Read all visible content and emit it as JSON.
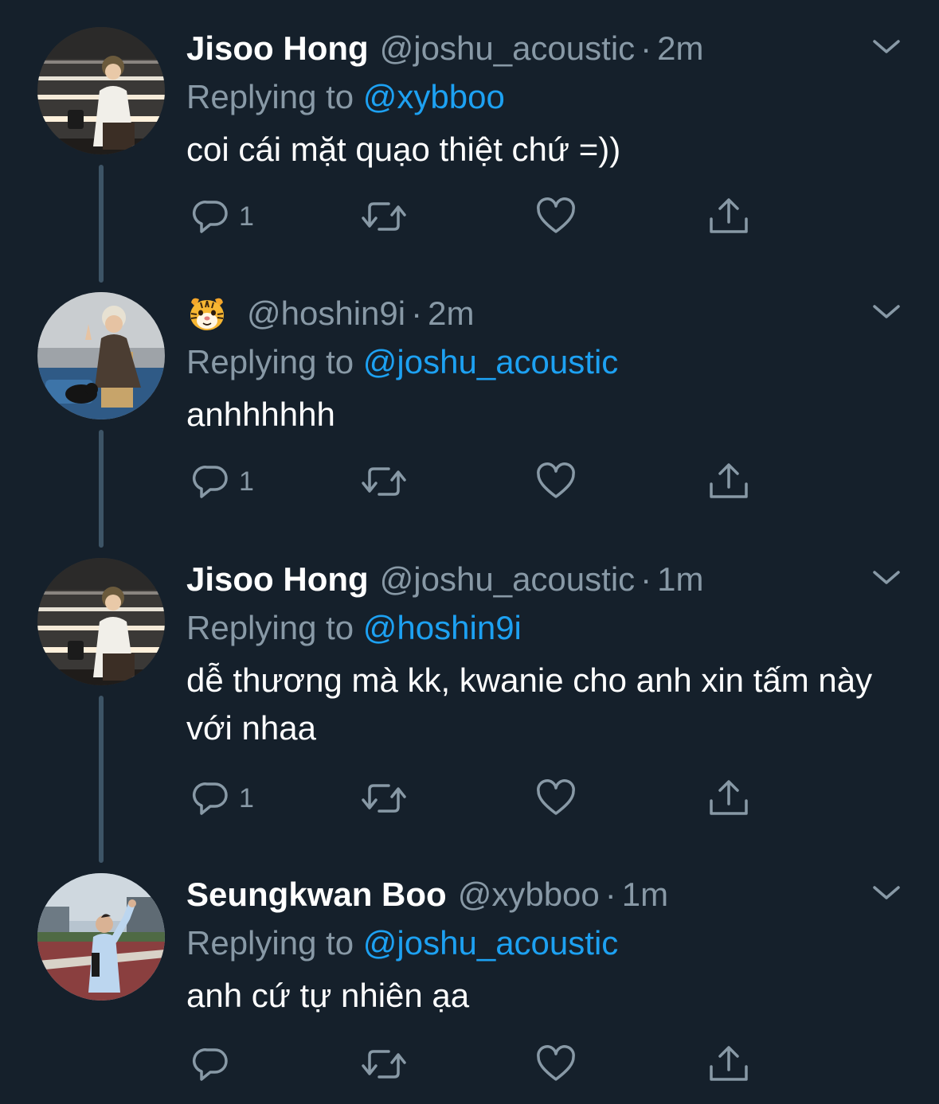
{
  "colors": {
    "background": "#15202b",
    "text_primary": "#ffffff",
    "text_secondary": "#8899a6",
    "mention": "#1da1f2",
    "thread_line": "#3d5466"
  },
  "tweets": [
    {
      "name": "Jisoo Hong",
      "handle": "@joshu_acoustic",
      "separator": "·",
      "time": "2m",
      "replying_prefix": "Replying to",
      "replying_to": "@xybboo",
      "text": "coi cái mặt quạo thiệt chứ =))",
      "reply_count": "1",
      "avatar": "avatar-photo-jisoo",
      "icons": [
        "reply-icon",
        "retweet-icon",
        "like-icon",
        "share-icon",
        "chevron-down-icon"
      ]
    },
    {
      "name_emoji": "🐯",
      "handle": "@hoshin9i",
      "separator": "·",
      "time": "2m",
      "replying_prefix": "Replying to",
      "replying_to": "@joshu_acoustic",
      "text": "anhhhhhh",
      "reply_count": "1",
      "avatar": "avatar-photo-hoshi",
      "icons": [
        "reply-icon",
        "retweet-icon",
        "like-icon",
        "share-icon",
        "chevron-down-icon"
      ]
    },
    {
      "name": "Jisoo Hong",
      "handle": "@joshu_acoustic",
      "separator": "·",
      "time": "1m",
      "replying_prefix": "Replying to",
      "replying_to": "@hoshin9i",
      "text": "dễ thương mà kk, kwanie cho anh xin tấm này với nhaa",
      "reply_count": "1",
      "avatar": "avatar-photo-jisoo",
      "icons": [
        "reply-icon",
        "retweet-icon",
        "like-icon",
        "share-icon",
        "chevron-down-icon"
      ]
    },
    {
      "name": "Seungkwan Boo",
      "handle": "@xybboo",
      "separator": "·",
      "time": "1m",
      "replying_prefix": "Replying to",
      "replying_to": "@joshu_acoustic",
      "text": "anh cứ tự nhiên ạa",
      "reply_count": "",
      "avatar": "avatar-photo-seungkwan",
      "icons": [
        "reply-icon",
        "retweet-icon",
        "like-icon",
        "share-icon",
        "chevron-down-icon"
      ]
    }
  ]
}
